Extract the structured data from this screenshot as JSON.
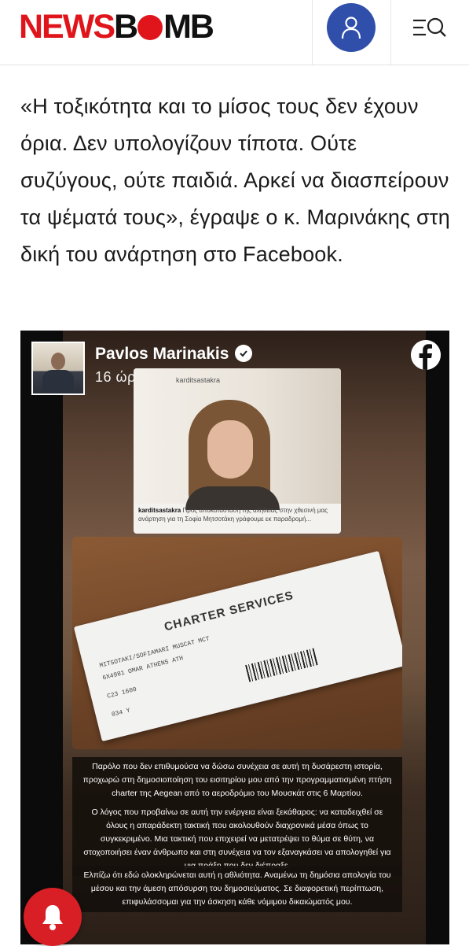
{
  "header": {
    "logo_part1": "NEWS",
    "logo_part2_a": "B",
    "logo_part2_b": "MB",
    "brand_color": "#e0151b",
    "user_button_color": "#2f4faa",
    "icons": [
      "user-icon",
      "menu-search-icon"
    ]
  },
  "article": {
    "paragraph": "«Η τοξικότητα και το μίσος τους δεν έχουν όρια. Δεν υπολογίζουν τίποτα. Ούτε συζύγους, ούτε παιδιά. Αρκεί να διασπείρουν τα ψέματά τους», έγραψε ο κ. Μαρινάκης στη δική του ανάρτηση στο Facebook."
  },
  "embed": {
    "poster_name": "Pavlos Marinakis",
    "post_time": "16 ώρες πριν",
    "photo_card": {
      "handle_top": "karditsastakra",
      "caption_handle": "karditsastakra",
      "caption_text": "Προς αποκατάσταση της αλήθειας στην χθεσινή μας ανάρτηση για τη Σοφία Μητσοτάκη γράφουμε εκ παραδρομή..."
    },
    "ticket": {
      "title": "CHARTER SERVICES",
      "row1": "MITSOTAKI/SOFIAMARI   MUSCAT   MCT",
      "row2": "6X4981   OMAR   ATHENS   ATH",
      "row3": "C23   1600",
      "row4": "034   Y"
    },
    "text_blocks": [
      "Παρόλο που δεν επιθυμούσα να δώσω συνέχεια σε αυτή τη δυσάρεστη ιστορία, προχωρώ στη δημοσιοποίηση του εισιτηρίου μου από την προγραμματισμένη πτήση charter της Aegean από το αεροδρόμιο του Μουσκάτ στις 6 Μαρτίου.",
      "Ο λόγος που προβαίνω σε αυτή την ενέργεια είναι ξεκάθαρος: να καταδειχθεί σε όλους η απαράδεκτη τακτική που ακολουθούν διαχρονικά μέσα όπως το συγκεκριμένο. Μια τακτική που επιχειρεί να μετατρέψει το θύμα σε θύτη, να στοχοποιήσει έναν άνθρωπο και στη συνέχεια να τον εξαναγκάσει να απολογηθεί για μια πράξη που δεν διέπραξε.",
      "Ελπίζω ότι εδώ ολοκληρώνεται αυτή η αθλιότητα. Αναμένω τη δημόσια απολογία του μέσου και την άμεση απόσυρση του δημοσιεύματος. Σε διαφορετική περίπτωση, επιφυλάσσομαι για την άσκηση κάθε νόμιμου δικαιώματός μου."
    ]
  },
  "notification_button_color": "#d81f26"
}
